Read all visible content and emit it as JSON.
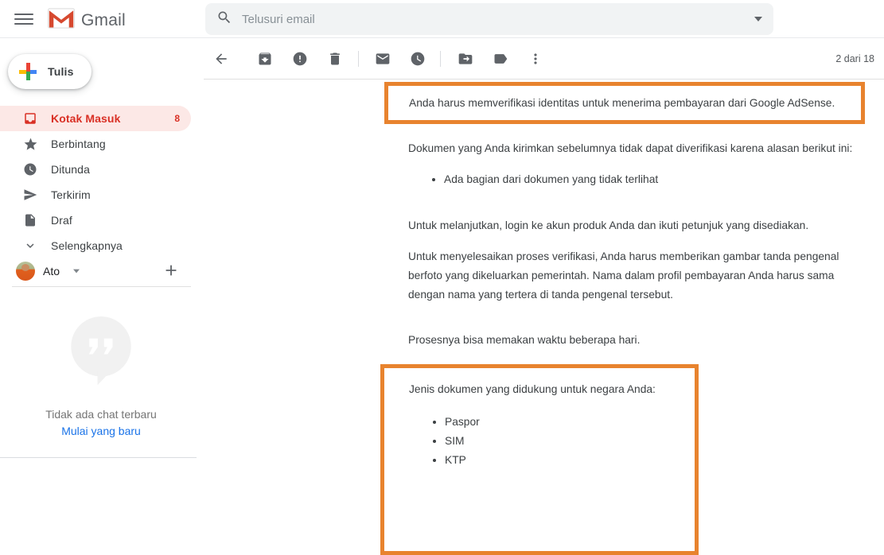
{
  "header": {
    "app_name": "Gmail",
    "search_placeholder": "Telusuri email"
  },
  "sidebar": {
    "compose_label": "Tulis",
    "items": [
      {
        "label": "Kotak Masuk",
        "icon": "inbox-icon",
        "count": "8",
        "active": true
      },
      {
        "label": "Berbintang",
        "icon": "star-icon"
      },
      {
        "label": "Ditunda",
        "icon": "clock-icon"
      },
      {
        "label": "Terkirim",
        "icon": "send-icon"
      },
      {
        "label": "Draf",
        "icon": "draft-icon"
      },
      {
        "label": "Selengkapnya",
        "icon": "chevron-down-icon"
      }
    ],
    "profile": {
      "name": "Ato"
    },
    "chat": {
      "empty_text": "Tidak ada chat terbaru",
      "new_chat_link": "Mulai yang baru"
    }
  },
  "toolbar": {
    "icons": [
      "back-icon",
      "archive-icon",
      "report-spam-icon",
      "delete-icon",
      "mark-unread-icon",
      "snooze-icon",
      "move-to-icon",
      "label-icon",
      "more-vert-icon"
    ],
    "pagination": "2 dari 18"
  },
  "email": {
    "highlight_box_1": "Anda harus memverifikasi identitas untuk menerima pembayaran dari Google AdSense.",
    "paragraph_1": "Dokumen yang Anda kirimkan sebelumnya tidak dapat diverifikasi karena alasan berikut ini:",
    "list_1": [
      "Ada bagian dari dokumen yang tidak terlihat"
    ],
    "paragraph_2": "Untuk melanjutkan, login ke akun produk Anda dan ikuti petunjuk yang disediakan.",
    "paragraph_3_lines": [
      "Untuk menyelesaikan proses verifikasi, Anda harus memberikan gambar tanda pengenal",
      "berfoto yang dikeluarkan pemerintah. Nama dalam profil pembayaran Anda harus sama",
      "dengan nama yang tertera di tanda pengenal tersebut."
    ],
    "paragraph_4": "Prosesnya bisa memakan waktu beberapa hari.",
    "highlight_box_2": {
      "title": "Jenis dokumen yang didukung untuk negara Anda:",
      "list": [
        "Paspor",
        "SIM",
        "KTP"
      ]
    }
  },
  "colors": {
    "highlight_orange": "#e8832e",
    "active_red": "#d93025",
    "active_bg_pink": "#fce8e6",
    "link_blue": "#1a73e8",
    "icon_gray": "#5f6368"
  }
}
